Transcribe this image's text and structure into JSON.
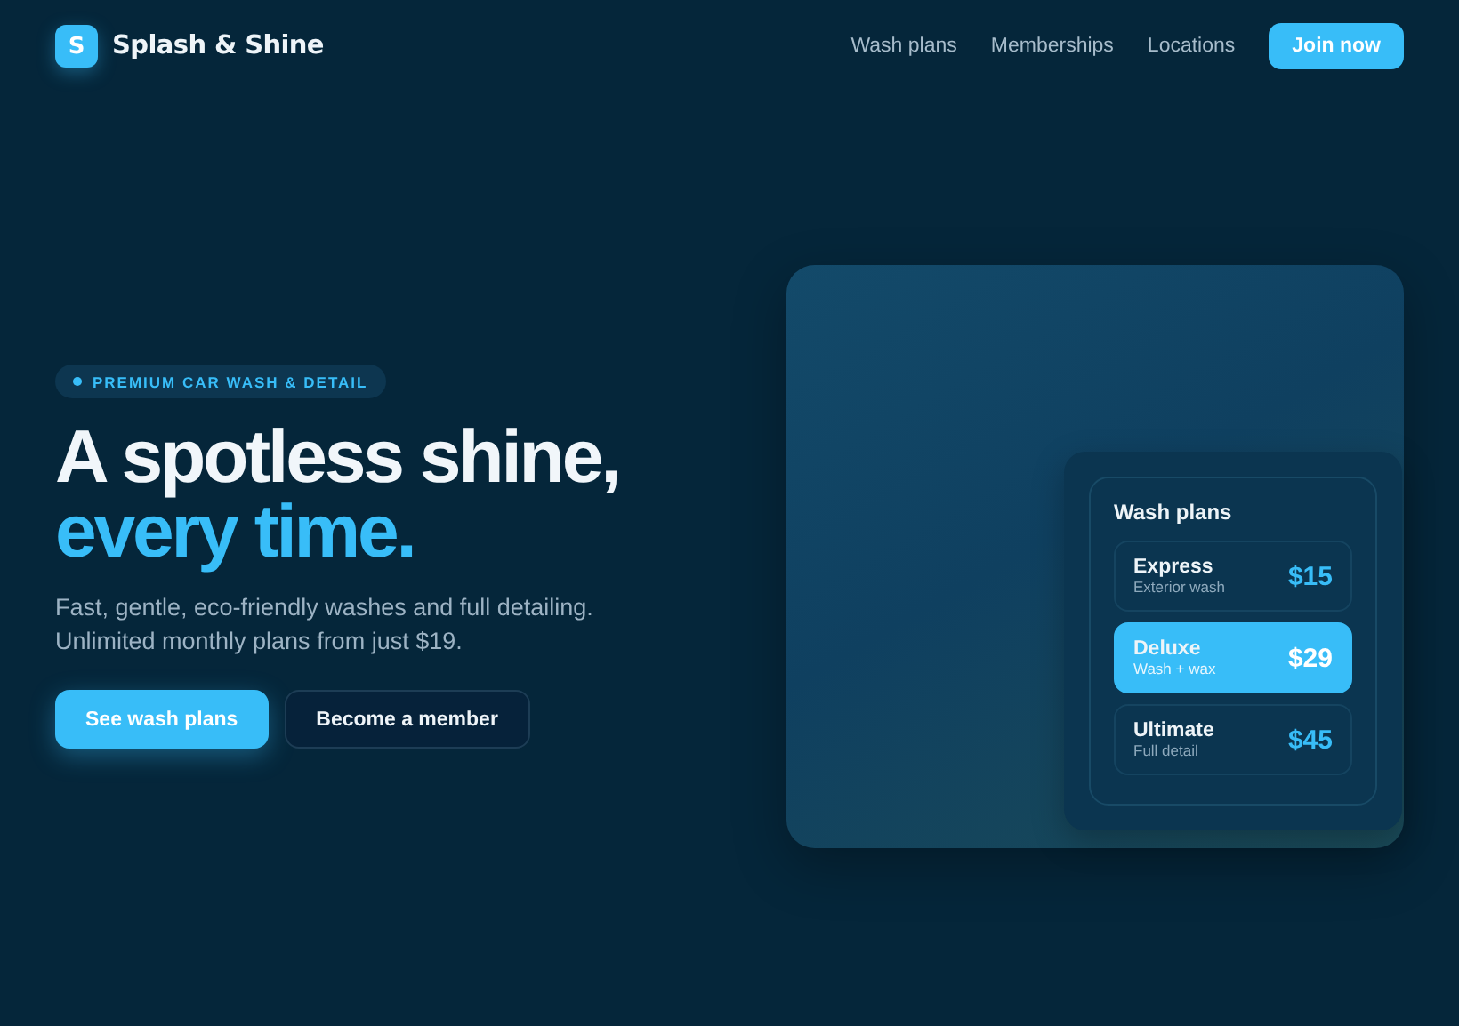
{
  "brand": {
    "logo_letter": "S",
    "name": "Splash & Shine"
  },
  "nav": {
    "links": [
      "Wash plans",
      "Memberships",
      "Locations"
    ],
    "cta": "Join now"
  },
  "hero": {
    "badge": "PREMIUM CAR WASH & DETAIL",
    "title_line1": "A spotless shine,",
    "title_line2": "every time.",
    "subtitle": "Fast, gentle, eco-friendly washes and full detailing. Unlimited monthly plans from just $19.",
    "primary_button": "See wash plans",
    "secondary_button": "Become a member"
  },
  "plans_card": {
    "title": "Wash plans",
    "plans": [
      {
        "name": "Express",
        "detail": "Exterior wash",
        "price": "$15",
        "selected": false
      },
      {
        "name": "Deluxe",
        "detail": "Wash + wax",
        "price": "$29",
        "selected": true
      },
      {
        "name": "Ultimate",
        "detail": "Full detail",
        "price": "$45",
        "selected": false
      }
    ]
  }
}
